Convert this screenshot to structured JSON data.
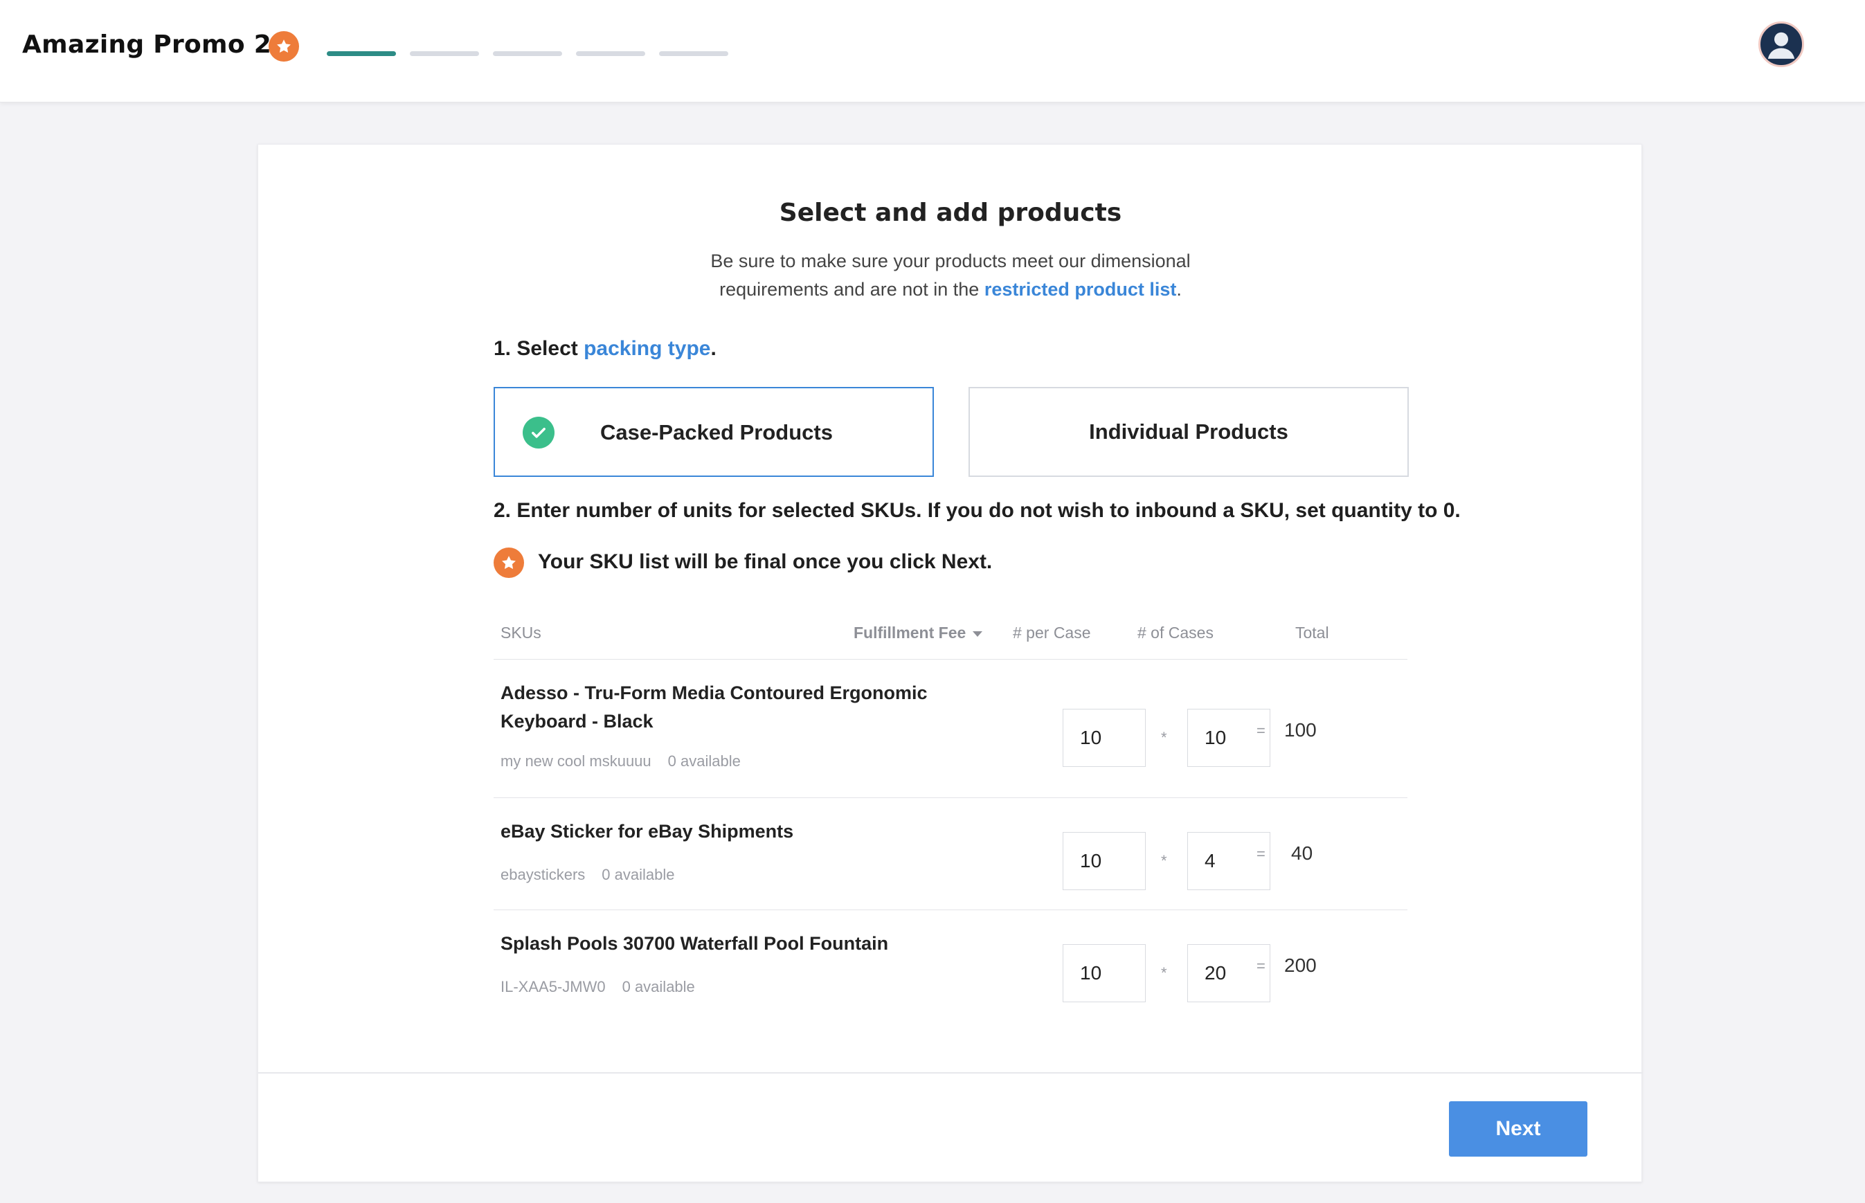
{
  "header": {
    "title": "Amazing Promo 2",
    "progress_steps": 5,
    "progress_active": 1,
    "star_icon": "star-icon",
    "avatar_icon": "user-avatar-icon"
  },
  "colors": {
    "accent": "#3a86d8",
    "progress_active": "#2d8c86",
    "star": "#ee7c3a",
    "check": "#3bbf8b",
    "button": "#4a8fe3"
  },
  "main": {
    "heading": "Select and add products",
    "subtext_line1": "Be sure to make sure your products meet our dimensional",
    "subtext_line2_prefix": "requirements and are not in the ",
    "subtext_link": "restricted product list",
    "subtext_line2_suffix": ".",
    "step1_prefix": "1. Select ",
    "step1_link": "packing type",
    "step1_suffix": ".",
    "packing_options": [
      {
        "label": "Case-Packed Products",
        "selected": true
      },
      {
        "label": "Individual Products",
        "selected": false
      }
    ],
    "step2": "2. Enter number of units for selected SKUs. If you do not wish to inbound a SKU, set quantity to 0.",
    "warning": "Your SKU list will be final once you click Next."
  },
  "table": {
    "headers": {
      "sku": "SKUs",
      "fee": "Fulfillment Fee",
      "per_case": "# per Case",
      "cases": "# of Cases",
      "total": "Total"
    },
    "rows": [
      {
        "name": "Adesso - Tru-Form Media Contoured Ergonomic Keyboard - Black",
        "sku": "my new cool mskuuuu",
        "available": "0 available",
        "per_case": "10",
        "cases": "10",
        "total": "100"
      },
      {
        "name": "eBay Sticker for eBay Shipments",
        "sku": "ebaystickers",
        "available": "0 available",
        "per_case": "10",
        "cases": "4",
        "total": "40"
      },
      {
        "name": "Splash Pools 30700 Waterfall Pool Fountain",
        "sku": "IL-XAA5-JMW0",
        "available": "0 available",
        "per_case": "10",
        "cases": "20",
        "total": "200"
      }
    ],
    "multiply_sign": "*",
    "equals_sign": "="
  },
  "footer": {
    "next_label": "Next"
  }
}
